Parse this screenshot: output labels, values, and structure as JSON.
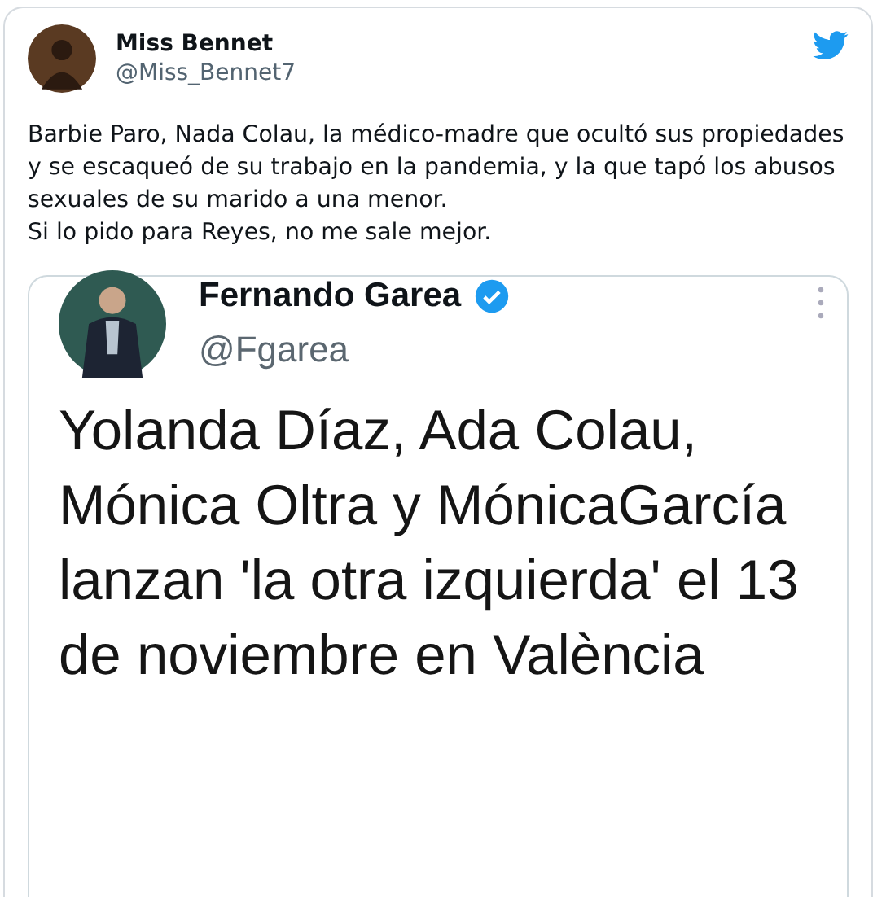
{
  "tweet": {
    "author": {
      "name": "Miss Bennet",
      "handle": "@Miss_Bennet7"
    },
    "text": "Barbie Paro, Nada Colau, la médico-madre que ocultó sus propiedades y se escaqueó de su trabajo en la pandemia, y la que tapó los abusos sexuales de su marido a una menor.\nSi lo pido para Reyes, no me sale mejor.",
    "attached_screenshot": {
      "author": {
        "name": "Fernando Garea",
        "handle": "@Fgarea",
        "verified": true
      },
      "text": "Yolanda Díaz, Ada Colau, Mónica Oltra y MónicaGarcía lanzan 'la otra izquierda' el 13 de noviembre en València"
    }
  }
}
